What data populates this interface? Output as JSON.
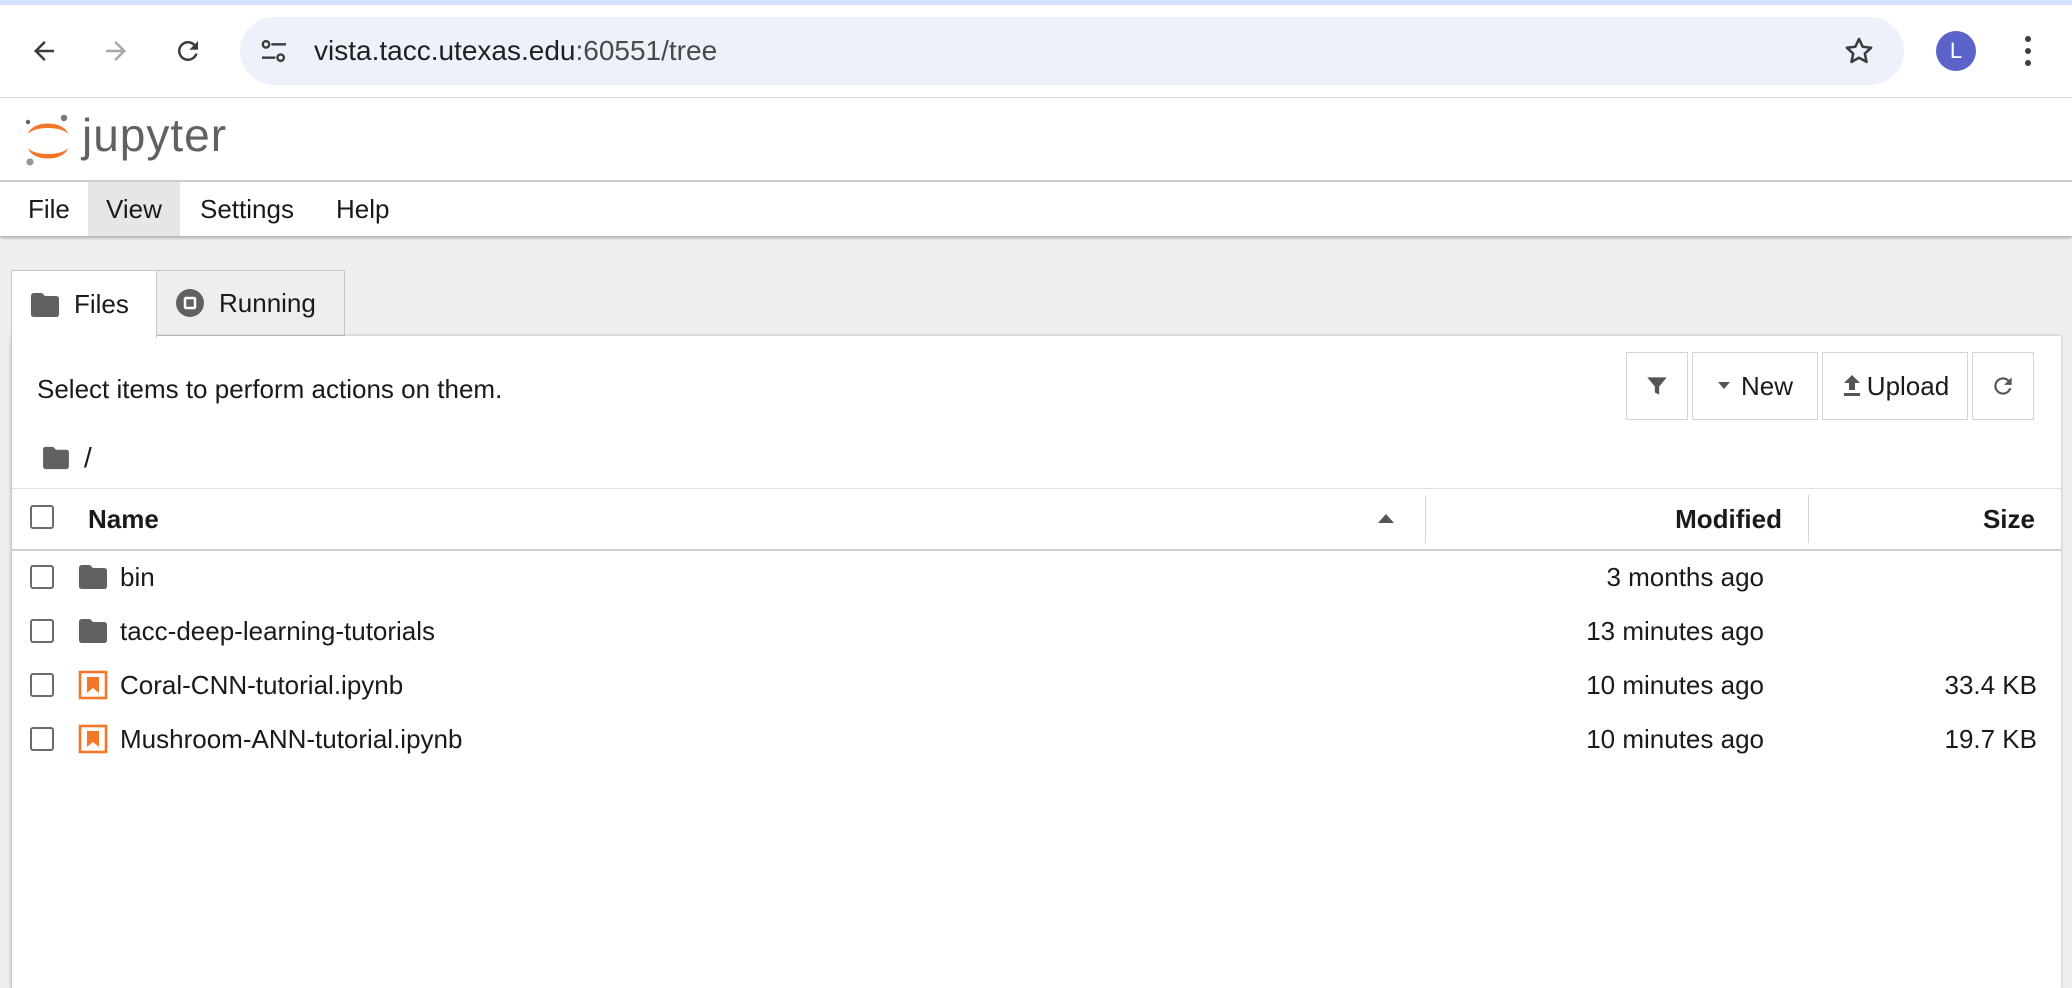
{
  "browser": {
    "url_host": "vista.tacc.utexas.edu",
    "url_rest": ":60551/tree",
    "avatar_letter": "L",
    "accent": "#d3e2fb"
  },
  "app": {
    "logo_text": "jupyter",
    "logo_color": "#f37726"
  },
  "menubar": {
    "items": [
      {
        "label": "File"
      },
      {
        "label": "View"
      },
      {
        "label": "Settings"
      },
      {
        "label": "Help"
      }
    ],
    "active": "View"
  },
  "tabs": [
    {
      "label": "Files",
      "icon": "folder-icon",
      "selected": true
    },
    {
      "label": "Running",
      "icon": "stop-circle-icon",
      "selected": false
    }
  ],
  "file_browser": {
    "message": "Select items to perform actions on them.",
    "toolbar": {
      "filter_icon": "filter-icon",
      "new_label": "New",
      "upload_label": "Upload",
      "refresh_icon": "refresh-icon"
    },
    "breadcrumb": "/",
    "columns": {
      "name": "Name",
      "modified": "Modified",
      "size": "Size"
    },
    "sort": {
      "column": "Name",
      "direction": "ascending"
    },
    "rows": [
      {
        "name": "bin",
        "type": "folder",
        "icon": "folder-icon",
        "modified": "3 months ago",
        "size": ""
      },
      {
        "name": "tacc-deep-learning-tutorials",
        "type": "folder",
        "icon": "folder-icon",
        "modified": "13 minutes ago",
        "size": ""
      },
      {
        "name": "Coral-CNN-tutorial.ipynb",
        "type": "notebook",
        "icon": "notebook-icon",
        "modified": "10 minutes ago",
        "size": "33.4 KB"
      },
      {
        "name": "Mushroom-ANN-tutorial.ipynb",
        "type": "notebook",
        "icon": "notebook-icon",
        "modified": "10 minutes ago",
        "size": "19.7 KB"
      }
    ]
  }
}
